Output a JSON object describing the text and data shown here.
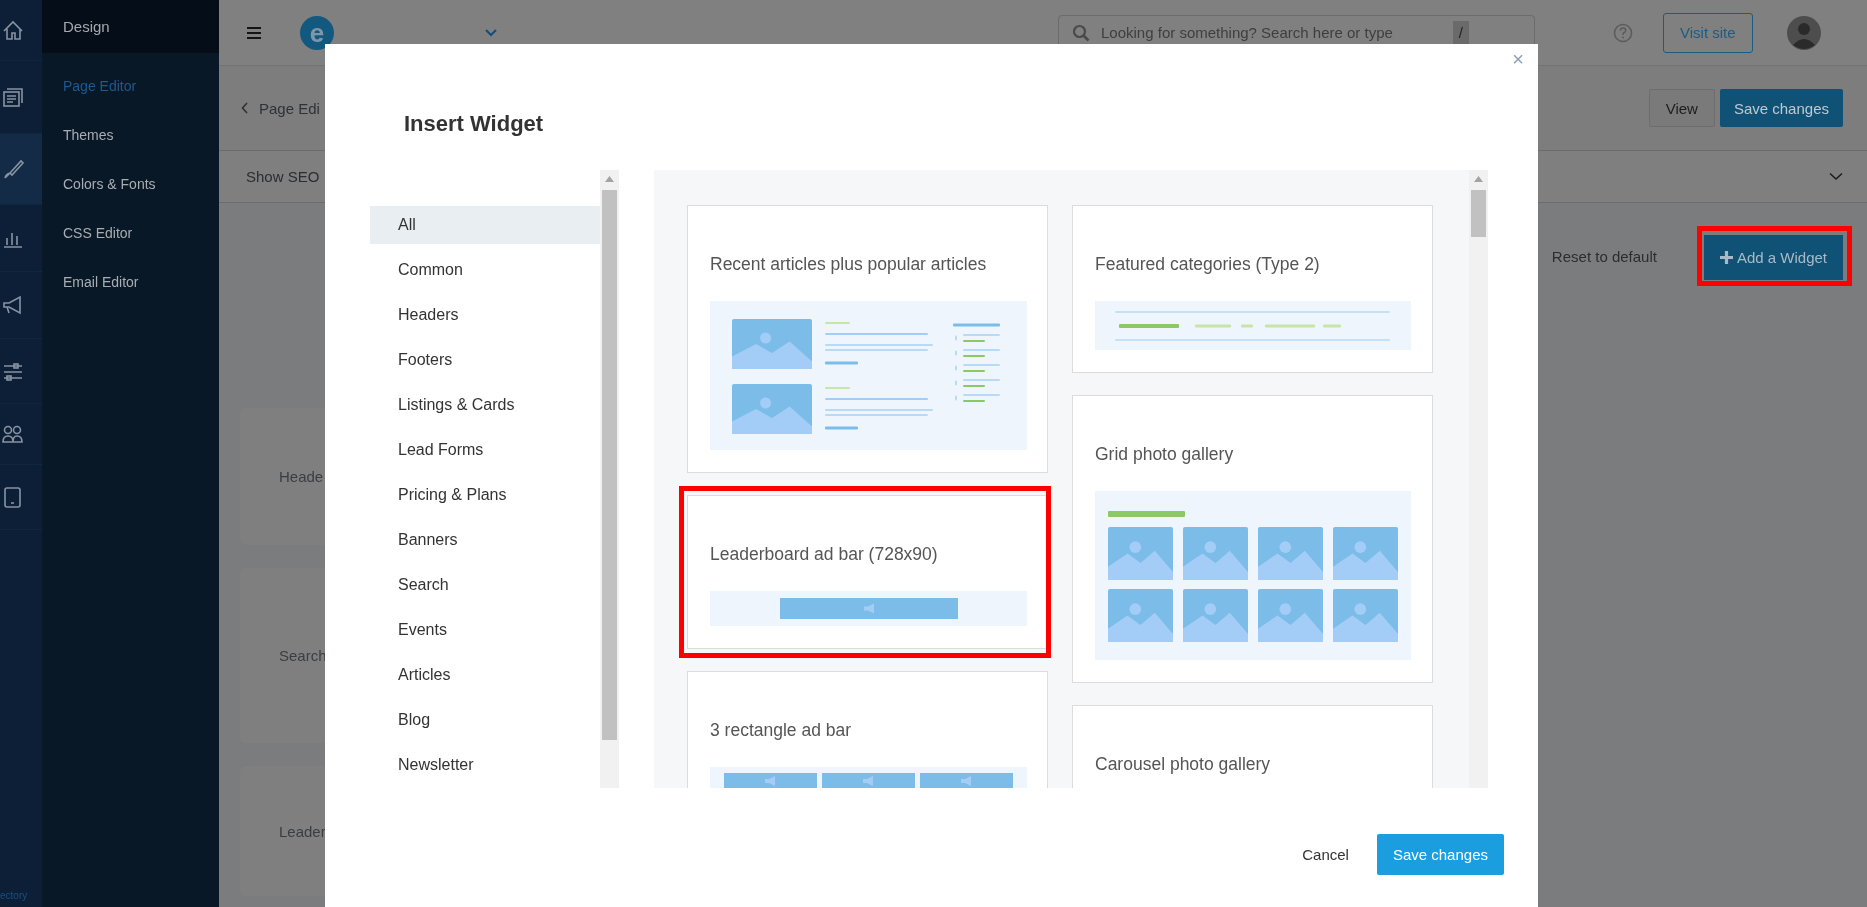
{
  "icon_rail": {
    "items": [
      {
        "selected": false
      },
      {
        "selected": false
      },
      {
        "selected": true
      },
      {
        "selected": false
      },
      {
        "selected": false
      },
      {
        "selected": false
      },
      {
        "selected": false
      },
      {
        "selected": false
      }
    ],
    "footer": "ectory"
  },
  "sidebar": {
    "heading": "Design",
    "items": [
      {
        "label": "Page Editor",
        "selected": true
      },
      {
        "label": "Themes",
        "selected": false
      },
      {
        "label": "Colors & Fonts",
        "selected": false
      },
      {
        "label": "CSS Editor",
        "selected": false
      },
      {
        "label": "Email Editor",
        "selected": false
      }
    ]
  },
  "topbar": {
    "logo": "e",
    "search": {
      "placeholder": "Looking for something? Search here or type",
      "shortcut": "/"
    },
    "visit_site": "Visit site"
  },
  "page_header": {
    "back": "Page Edi",
    "view": "View",
    "save": "Save changes"
  },
  "seo_bar": {
    "label": "Show SEO"
  },
  "layout_rows": [
    "Heade",
    "Search",
    "Leader"
  ],
  "actions": {
    "reset": "Reset to default",
    "add_widget": {
      "label": "Add a Widget",
      "highlighted": true
    }
  },
  "modal": {
    "title": "Insert Widget",
    "close": "×",
    "categories": [
      {
        "label": "All",
        "selected": true
      },
      {
        "label": "Common",
        "selected": false
      },
      {
        "label": "Headers",
        "selected": false
      },
      {
        "label": "Footers",
        "selected": false
      },
      {
        "label": "Listings & Cards",
        "selected": false
      },
      {
        "label": "Lead Forms",
        "selected": false
      },
      {
        "label": "Pricing & Plans",
        "selected": false
      },
      {
        "label": "Banners",
        "selected": false
      },
      {
        "label": "Search",
        "selected": false
      },
      {
        "label": "Events",
        "selected": false
      },
      {
        "label": "Articles",
        "selected": false
      },
      {
        "label": "Blog",
        "selected": false
      },
      {
        "label": "Newsletter",
        "selected": false
      }
    ],
    "widget_columns": [
      {
        "cards": [
          {
            "title": "Recent articles plus popular articles",
            "kind": "articles",
            "highlighted": false
          },
          {
            "title": "Leaderboard ad bar (728x90)",
            "kind": "leaderboard",
            "highlighted": true
          },
          {
            "title": "3 rectangle ad bar",
            "kind": "rectangles",
            "highlighted": false
          }
        ]
      },
      {
        "cards": [
          {
            "title": "Featured categories (Type 2)",
            "kind": "categories",
            "highlighted": false
          },
          {
            "title": "Grid photo gallery",
            "kind": "gallery",
            "highlighted": false
          },
          {
            "title": "Carousel photo gallery",
            "kind": "plain",
            "highlighted": false
          }
        ]
      }
    ],
    "cancel": "Cancel",
    "save": "Save changes"
  }
}
